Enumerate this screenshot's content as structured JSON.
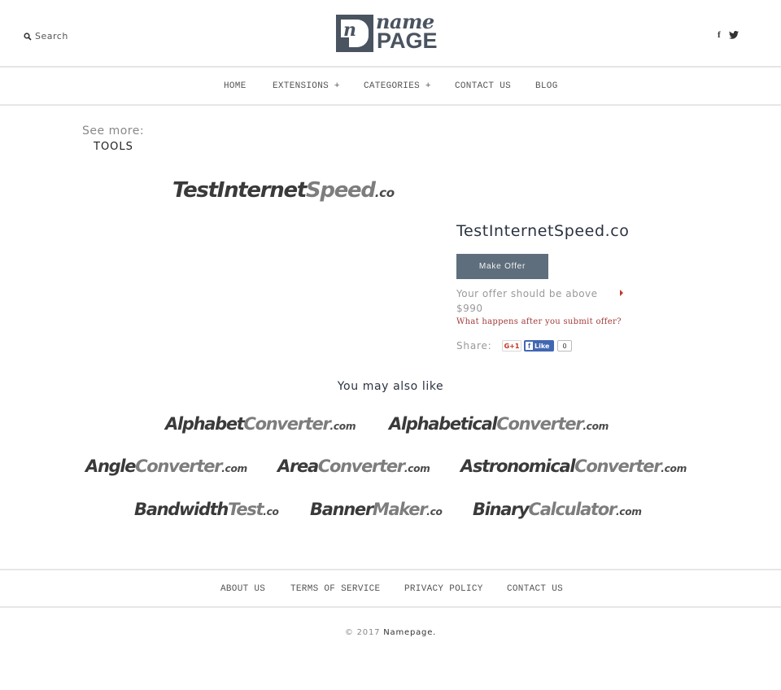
{
  "header": {
    "search_label": "Search",
    "search_icon": "search-icon",
    "logo": {
      "top_text": "name",
      "bottom_text": "PAGE",
      "monogram": "n"
    },
    "social": [
      {
        "name": "facebook-icon",
        "glyph": "f"
      },
      {
        "name": "twitter-icon",
        "glyph": "🐦"
      }
    ]
  },
  "nav": {
    "items": [
      {
        "label": "HOME"
      },
      {
        "label": "EXTENSIONS +"
      },
      {
        "label": "CATEGORIES +"
      },
      {
        "label": "CONTACT US"
      },
      {
        "label": "BLOG"
      }
    ]
  },
  "sidebar": {
    "see_more_label": "See more:",
    "category": "TOOLS"
  },
  "product": {
    "logo": {
      "part_a": "TestInternet",
      "part_b": "Speed",
      "tld": ".co"
    },
    "domain": "TestInternetSpeed.co",
    "make_offer_label": "Make Offer",
    "offer_hint": "Your offer should be above $990",
    "what_happens_link": "What happens after you submit offer?",
    "share_label": "Share:",
    "gplus_label": "G+1",
    "fb_like_label": "Like",
    "fb_like_count": "0"
  },
  "suggestions": {
    "title": "You may also like",
    "items": [
      {
        "part_a": "Alphabet",
        "part_b": "Converter",
        "tld": ".com"
      },
      {
        "part_a": "Alphabetical",
        "part_b": "Converter",
        "tld": ".com"
      },
      {
        "part_a": "Angle",
        "part_b": "Converter",
        "tld": ".com"
      },
      {
        "part_a": "Area",
        "part_b": "Converter",
        "tld": ".com"
      },
      {
        "part_a": "Astronomical",
        "part_b": "Converter",
        "tld": ".com"
      },
      {
        "part_a": "Bandwidth",
        "part_b": "Test",
        "tld": ".co"
      },
      {
        "part_a": "Banner",
        "part_b": "Maker",
        "tld": ".co"
      },
      {
        "part_a": "Binary",
        "part_b": "Calculator",
        "tld": ".com"
      }
    ]
  },
  "footer": {
    "links": [
      {
        "label": "ABOUT US"
      },
      {
        "label": "TERMS OF SERVICE"
      },
      {
        "label": "PRIVACY POLICY"
      },
      {
        "label": "CONTACT US"
      }
    ],
    "copyright_prefix": "© 2017",
    "company": "Namepage."
  },
  "colors": {
    "brand_dark": "#4a5360",
    "button": "#5f6e7c",
    "link_red": "#a33a3a",
    "facebook_blue": "#4267b2"
  }
}
